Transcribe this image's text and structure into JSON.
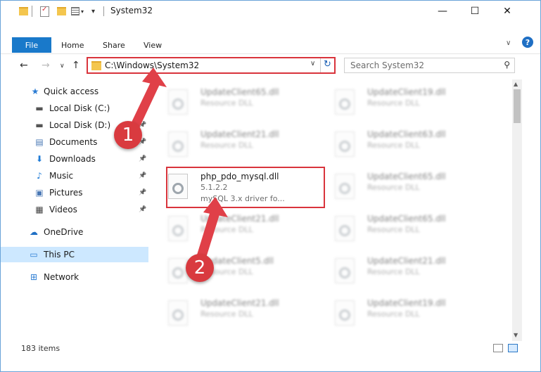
{
  "window": {
    "title": "System32",
    "minimize": "—",
    "maximize": "☐",
    "close": "✕"
  },
  "ribbon": {
    "tabs": [
      "File",
      "Home",
      "Share",
      "View"
    ],
    "expand": "∨",
    "help": "?"
  },
  "nav": {
    "back": "←",
    "forward": "→",
    "recent": "∨",
    "up": "↑"
  },
  "address": {
    "path": "C:\\Windows\\System32",
    "dropdown": "∨",
    "refresh": "↻"
  },
  "search": {
    "placeholder": "Search System32",
    "icon": "⚲"
  },
  "sidebar": {
    "items": [
      {
        "label": "Quick access",
        "icon": "star-icon",
        "glyph": "★",
        "color": "#2b7cd3",
        "pinned": false
      },
      {
        "label": "Local Disk (C:)",
        "icon": "drive-icon",
        "glyph": "▬",
        "color": "#555555",
        "pinned": true
      },
      {
        "label": "Local Disk (D:)",
        "icon": "drive-icon",
        "glyph": "▬",
        "color": "#555555",
        "pinned": true
      },
      {
        "label": "Documents",
        "icon": "documents-icon",
        "glyph": "▤",
        "color": "#4a78b5",
        "pinned": true
      },
      {
        "label": "Downloads",
        "icon": "download-icon",
        "glyph": "⬇",
        "color": "#1f7bd6",
        "pinned": true
      },
      {
        "label": "Music",
        "icon": "music-icon",
        "glyph": "♪",
        "color": "#1f7bd6",
        "pinned": true
      },
      {
        "label": "Pictures",
        "icon": "pictures-icon",
        "glyph": "▣",
        "color": "#4a78b5",
        "pinned": true
      },
      {
        "label": "Videos",
        "icon": "videos-icon",
        "glyph": "▦",
        "color": "#444444",
        "pinned": true
      },
      {
        "label": "OneDrive",
        "icon": "cloud-icon",
        "glyph": "☁",
        "color": "#1f6fc4",
        "pinned": false
      },
      {
        "label": "This PC",
        "icon": "computer-icon",
        "glyph": "▭",
        "color": "#2b7cd3",
        "pinned": false
      },
      {
        "label": "Network",
        "icon": "network-icon",
        "glyph": "⊞",
        "color": "#2b7cd3",
        "pinned": false
      }
    ],
    "pin_glyph": "📌"
  },
  "files": [
    {
      "name": "UpdateClient65.dll",
      "sub": "Resource DLL",
      "version": ""
    },
    {
      "name": "UpdateClient19.dll",
      "sub": "Resource DLL",
      "version": ""
    },
    {
      "name": "UpdateClient21.dll",
      "sub": "Resource DLL",
      "version": ""
    },
    {
      "name": "UpdateClient63.dll",
      "sub": "Resource DLL",
      "version": ""
    },
    {
      "name": "php_pdo_mysql.dll",
      "sub": "mySQL 3.x driver fo...",
      "version": "5.1.2.2"
    },
    {
      "name": "UpdateClient65.dll",
      "sub": "Resource DLL",
      "version": ""
    },
    {
      "name": "UpdateClient21.dll",
      "sub": "Resource DLL",
      "version": ""
    },
    {
      "name": "UpdateClient65.dll",
      "sub": "Resource DLL",
      "version": ""
    },
    {
      "name": "UpdateClient5.dll",
      "sub": "Resource DLL",
      "version": ""
    },
    {
      "name": "UpdateClient21.dll",
      "sub": "Resource DLL",
      "version": ""
    },
    {
      "name": "UpdateClient21.dll",
      "sub": "Resource DLL",
      "version": ""
    },
    {
      "name": "UpdateClient19.dll",
      "sub": "Resource DLL",
      "version": ""
    }
  ],
  "status": {
    "count": "183 items"
  },
  "annotations": {
    "step1": "1",
    "step2": "2"
  },
  "colors": {
    "accent": "#1979ca",
    "highlight": "#d9343c",
    "selected": "#cde8ff"
  }
}
